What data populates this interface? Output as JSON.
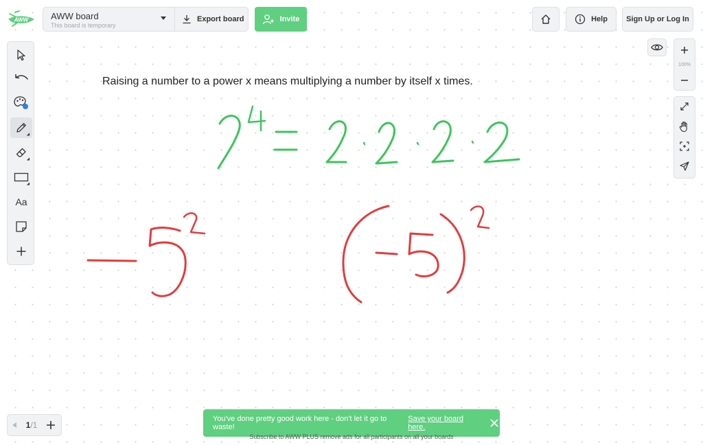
{
  "app": {
    "logo_text": "AWW",
    "colors": {
      "brand_green": "#5fcf80",
      "ink_green": "#3cc55a",
      "ink_red": "#e33b3b",
      "panel": "#f1f2f4"
    }
  },
  "header": {
    "board_title": "AWW board",
    "board_subtitle": "This board is temporary",
    "export_label": "Export board",
    "invite_label": "Invite",
    "help_label": "Help",
    "login_label": "Sign Up or Log In"
  },
  "toolbar": {
    "text_tool_label": "Aa",
    "tools": [
      "select-icon",
      "undo-icon",
      "palette-icon",
      "pencil-icon",
      "eraser-icon",
      "rectangle-icon",
      "text-icon",
      "sticky-note-icon",
      "plus-icon"
    ]
  },
  "zoom": {
    "level": "100%"
  },
  "canvas": {
    "text": "Raising a number to a power x means multiplying a number by itself x times."
  },
  "pages": {
    "current": "1",
    "total": "/1"
  },
  "toast": {
    "message": "You've done pretty good work here - don't let it go to waste!",
    "link": "Save your board here."
  },
  "footer": {
    "subscribe_text": "Subscribe to AWW PLUS remove ads for all participants on all your boards"
  }
}
